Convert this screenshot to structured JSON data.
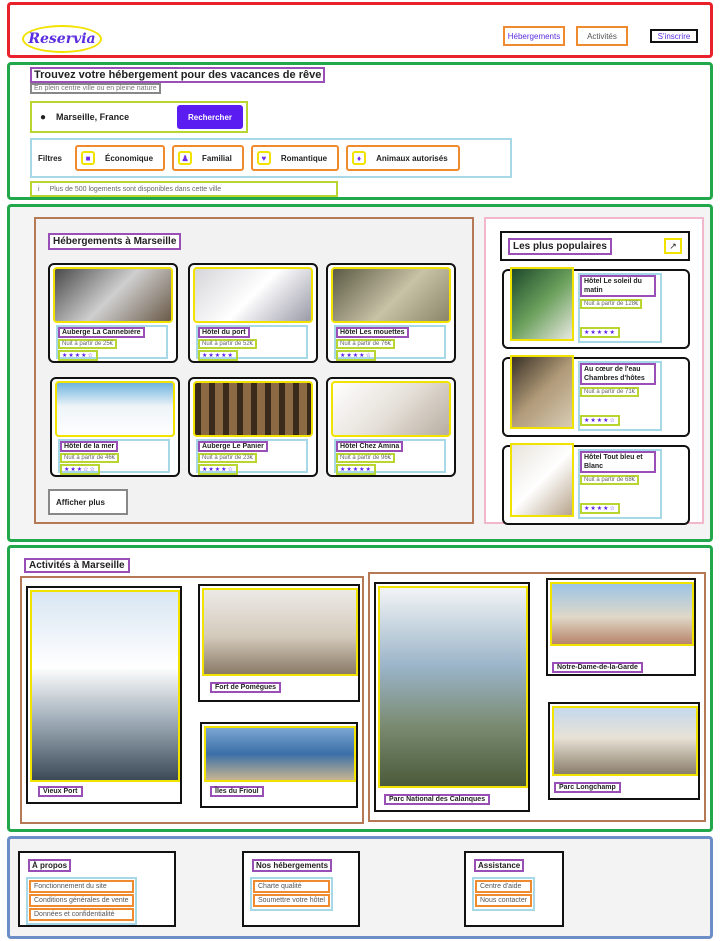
{
  "header": {
    "logo": "Reservia",
    "nav": {
      "hebergements": "Hébergements",
      "activites": "Activités",
      "inscrire": "S'inscrire"
    }
  },
  "search": {
    "title": "Trouvez votre hébergement pour des vacances de rêve",
    "subtitle": "En plein centre ville ou en pleine nature",
    "location": "Marseille, France",
    "button": "Rechercher",
    "filters_label": "Filtres",
    "filters": [
      "Économique",
      "Familial",
      "Romantique",
      "Animaux autorisés"
    ],
    "info": "Plus de 500 logements sont disponibles dans cette ville"
  },
  "hotels": {
    "title": "Hébergements à Marseille",
    "items": [
      {
        "name": "Auberge La Cannebière",
        "price": "Nuit à partir de 25€",
        "stars": "★★★★☆"
      },
      {
        "name": "Hôtel du port",
        "price": "Nuit à partir de 52€",
        "stars": "★★★★★"
      },
      {
        "name": "Hôtel Les mouettes",
        "price": "Nuit à partir de 76€",
        "stars": "★★★★☆"
      },
      {
        "name": "Hôtel de la mer",
        "price": "Nuit à partir de 46€",
        "stars": "★★★☆☆"
      },
      {
        "name": "Auberge Le Panier",
        "price": "Nuit à partir de 23€",
        "stars": "★★★★☆"
      },
      {
        "name": "Hôtel Chez Amina",
        "price": "Nuit à partir de 96€",
        "stars": "★★★★★"
      }
    ],
    "more": "Afficher plus"
  },
  "popular": {
    "title": "Les plus populaires",
    "items": [
      {
        "name": "Hôtel Le soleil du matin",
        "price": "Nuit à partir de 128€",
        "stars": "★★★★★"
      },
      {
        "name": "Au cœur de l'eau Chambres d'hôtes",
        "price": "Nuit à partir de 71€",
        "stars": "★★★★☆"
      },
      {
        "name": "Hôtel Tout bleu et Blanc",
        "price": "Nuit à partir de 68€",
        "stars": "★★★★☆"
      }
    ]
  },
  "activities": {
    "title": "Activités à Marseille",
    "items": [
      "Vieux Port",
      "Fort de Pomègues",
      "Îles du Frioul",
      "Parc National des Calanques",
      "Notre-Dame-de-la-Garde",
      "Parc Longchamp"
    ]
  },
  "footer": {
    "cols": [
      {
        "title": "À propos",
        "links": [
          "Fonctionnement du site",
          "Conditions générales de vente",
          "Données et confidentialité"
        ]
      },
      {
        "title": "Nos hébergements",
        "links": [
          "Charte qualité",
          "Soumettre votre hôtel"
        ]
      },
      {
        "title": "Assistance",
        "links": [
          "Centre d'aide",
          "Nous contacter"
        ]
      }
    ]
  },
  "colors": {
    "accent": "#5a1cf0",
    "brand": "#5a2de0"
  }
}
